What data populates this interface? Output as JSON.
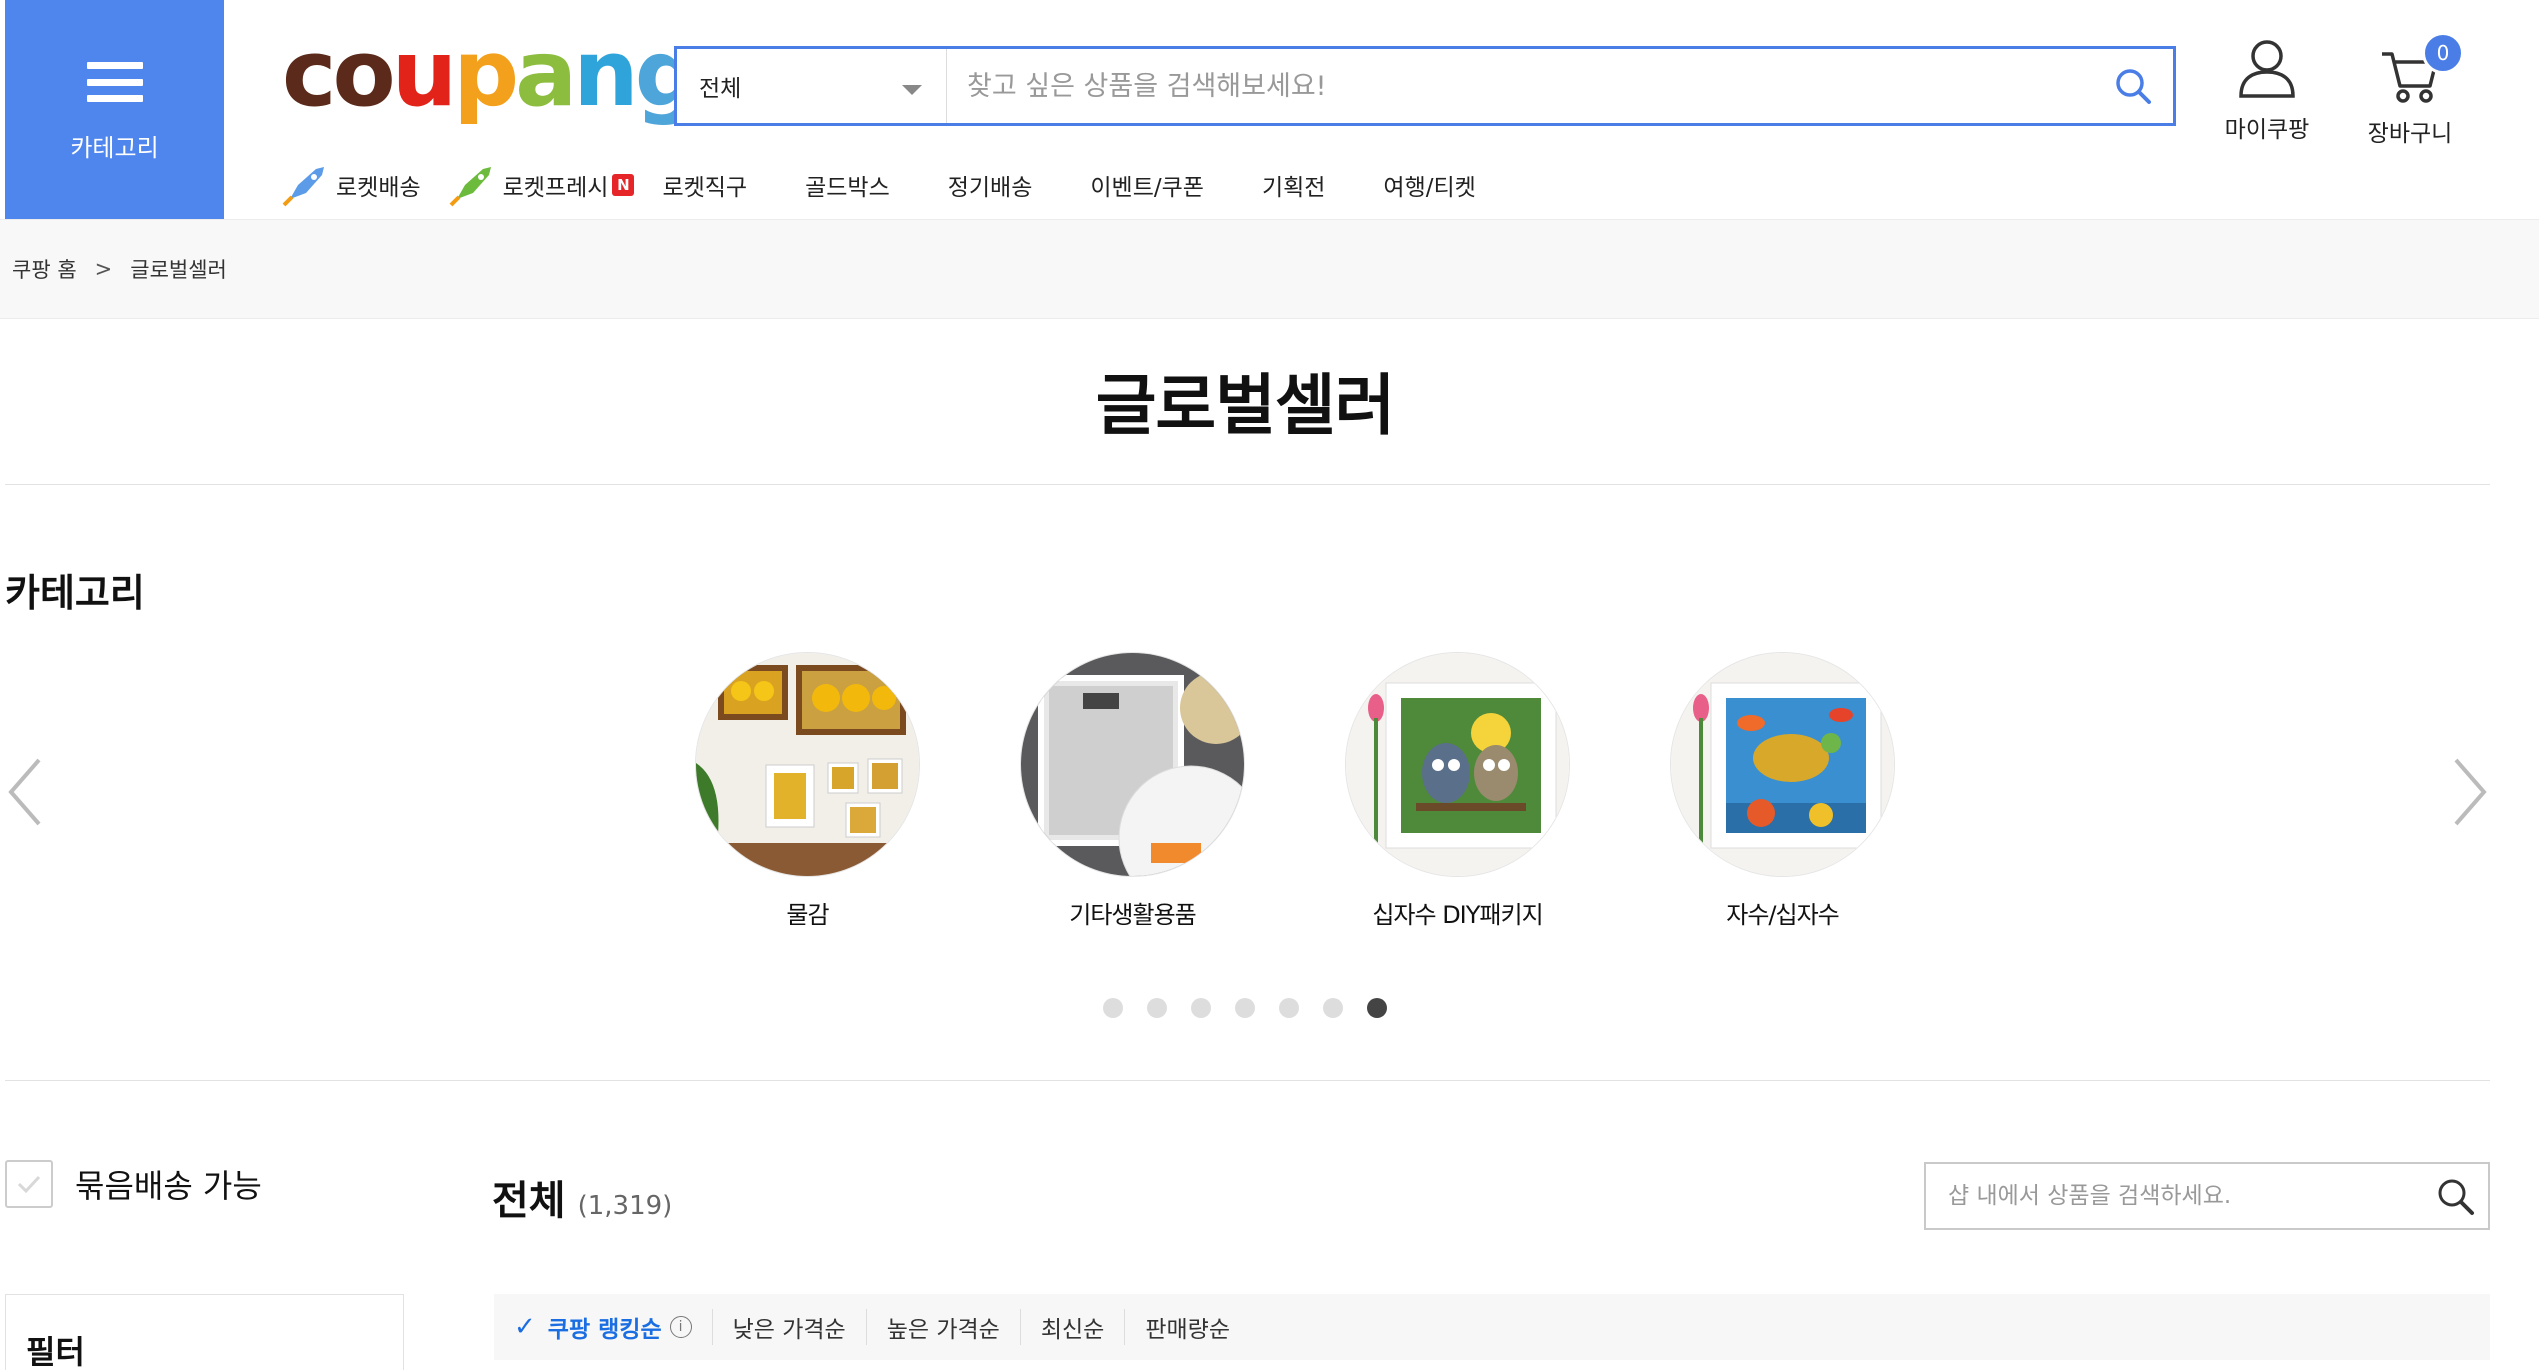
{
  "header": {
    "category_label": "카테고리",
    "logo": [
      "c",
      "o",
      "u",
      "p",
      "a",
      "n",
      "g"
    ],
    "logo_colors": [
      "#5b2a1a",
      "#5b2a1a",
      "#e2231a",
      "#f3a01c",
      "#8cbd3f",
      "#2ea4db",
      "#4ea5d9"
    ],
    "search": {
      "category_value": "전체",
      "placeholder": "찾고 싶은 상품을 검색해보세요!"
    },
    "my_coupang_label": "마이쿠팡",
    "cart_label": "장바구니",
    "cart_count": "0",
    "accent_color": "#4f86ee"
  },
  "nav": {
    "items": [
      {
        "label": "로켓배송",
        "icon": "rocket-icon"
      },
      {
        "label": "로켓프레시",
        "icon": "rocket-fresh-icon",
        "badge": "N"
      },
      {
        "label": "로켓직구"
      },
      {
        "label": "골드박스"
      },
      {
        "label": "정기배송"
      },
      {
        "label": "이벤트/쿠폰"
      },
      {
        "label": "기획전"
      },
      {
        "label": "여행/티켓"
      }
    ]
  },
  "breadcrumb": {
    "home": "쿠팡 홈",
    "separator": ">",
    "current": "글로벌셀러"
  },
  "page_title": "글로벌셀러",
  "category_section": {
    "title": "카테고리",
    "items": [
      {
        "name": "물감"
      },
      {
        "name": "기타생활용품"
      },
      {
        "name": "십자수 DIY패키지"
      },
      {
        "name": "자수/십자수"
      }
    ],
    "pagination": {
      "total": 7,
      "active_index": 6
    }
  },
  "listing": {
    "bundle_label": "묶음배송 가능",
    "filter_label": "필터",
    "all_label": "전체",
    "all_count": "(1,319)",
    "shop_search_placeholder": "샵 내에서 상품을 검색하세요.",
    "sort_options": [
      {
        "label": "쿠팡 랭킹순",
        "active": true
      },
      {
        "label": "낮은 가격순"
      },
      {
        "label": "높은 가격순"
      },
      {
        "label": "최신순"
      },
      {
        "label": "판매량순"
      }
    ]
  }
}
